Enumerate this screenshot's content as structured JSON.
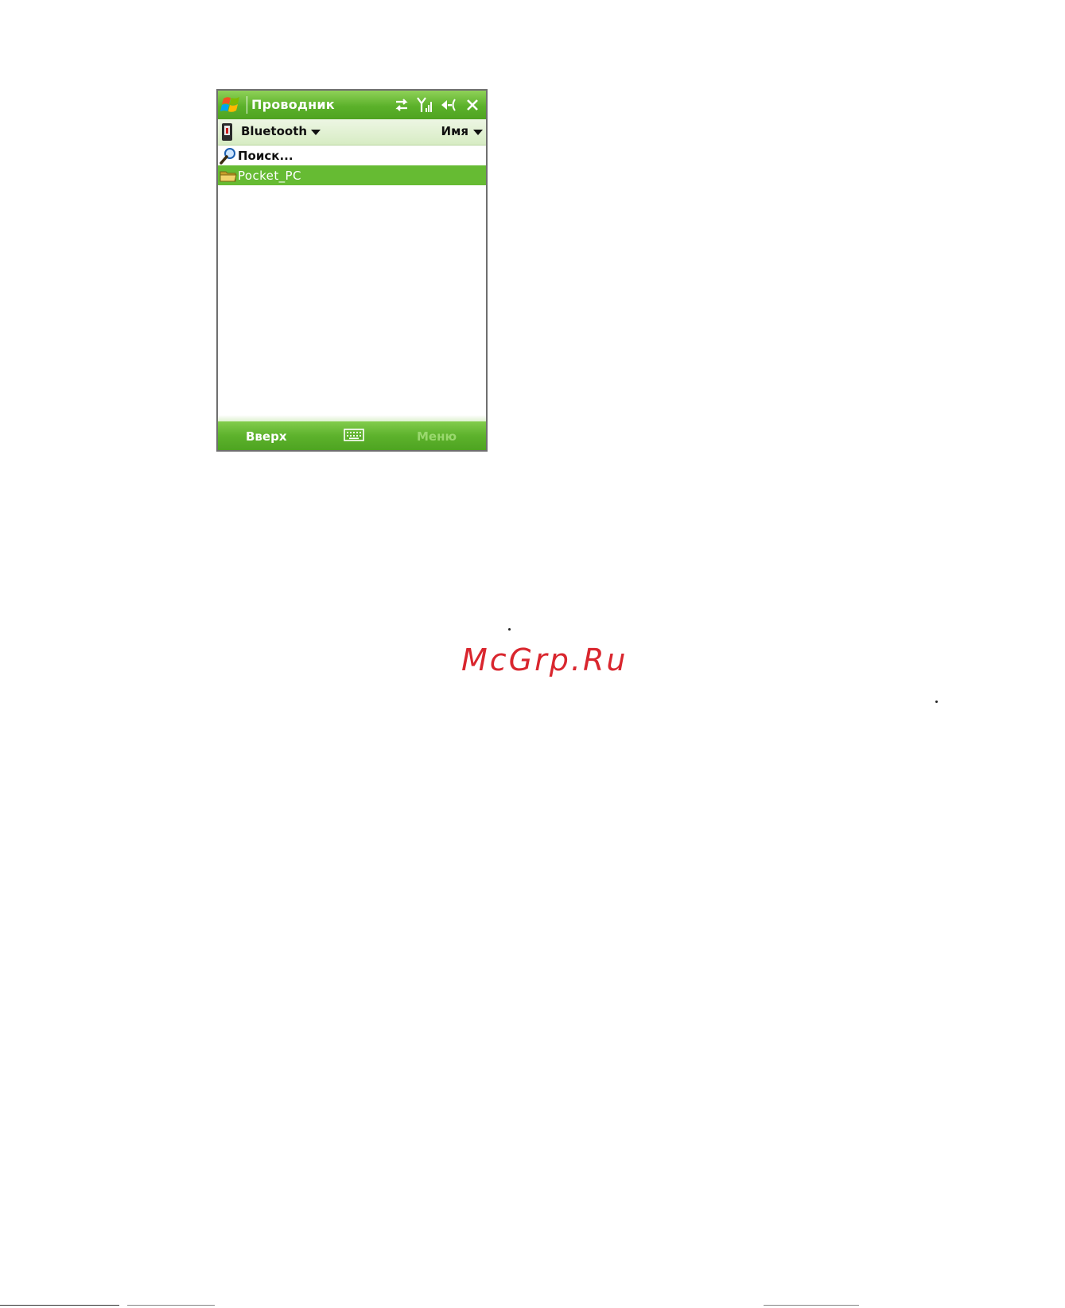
{
  "window": {
    "title": "Проводник",
    "accent_color": "#5bb12a",
    "status_icons": [
      "sync-icon",
      "signal-icon",
      "volume-icon",
      "close-icon"
    ]
  },
  "folder_bar": {
    "current_folder": "Bluetooth",
    "sort_by": "Имя"
  },
  "file_list": {
    "items": [
      {
        "label": "Поиск...",
        "icon": "search-icon",
        "selected": false
      },
      {
        "label": "Pocket_PC",
        "icon": "folder-icon",
        "selected": true
      }
    ]
  },
  "menu_bar": {
    "left_softkey": "Вверх",
    "center_icon": "keyboard-icon",
    "right_softkey": "Меню"
  },
  "watermark": "McGrp.Ru"
}
